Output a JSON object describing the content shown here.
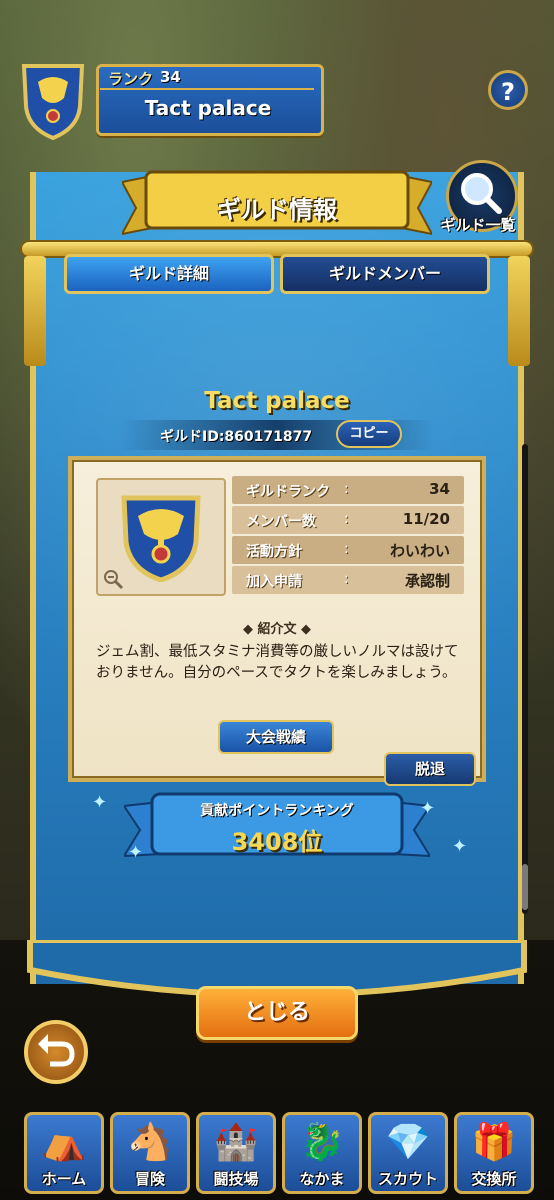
{
  "header": {
    "rank_label": "ランク",
    "rank_value": "34",
    "guild_name": "Tact palace",
    "help_label": "?"
  },
  "dialog": {
    "title": "ギルド情報",
    "guild_list_label": "ギルド一覧",
    "tabs": [
      {
        "label": "ギルド詳細",
        "active": true
      },
      {
        "label": "ギルドメンバー",
        "active": false
      }
    ],
    "guild_name": "Tact palace",
    "guild_id": "ギルドID:860171877",
    "copy_label": "コピー",
    "info": [
      {
        "label": "ギルドランク",
        "value": "34"
      },
      {
        "label": "メンバー数",
        "value": "11/20"
      },
      {
        "label": "活動方針",
        "value": "わいわい"
      },
      {
        "label": "加入申請",
        "value": "承認制"
      }
    ],
    "intro_label": "紹介文",
    "intro_text": "ジェム割、最低スタミナ消費等の厳しいノルマは設けておりません。自分のペースでタクトを楽しみましょう。",
    "tournament_label": "大会戦績",
    "leave_label": "脱退",
    "ranking_label": "貢献ポイントランキング",
    "ranking_value": "3408位",
    "close_label": "とじる"
  },
  "colors": {
    "banner_blue": "#2b86c7",
    "gold": "#e2c45c",
    "orange": "#f08a1c"
  },
  "nav": [
    {
      "label": "ホーム",
      "icon": "tent-icon"
    },
    {
      "label": "冒険",
      "icon": "wagon-icon"
    },
    {
      "label": "闘技場",
      "icon": "arena-icon"
    },
    {
      "label": "なかま",
      "icon": "monsters-icon"
    },
    {
      "label": "スカウト",
      "icon": "crystal-icon"
    },
    {
      "label": "交換所",
      "icon": "shop-icon"
    }
  ]
}
